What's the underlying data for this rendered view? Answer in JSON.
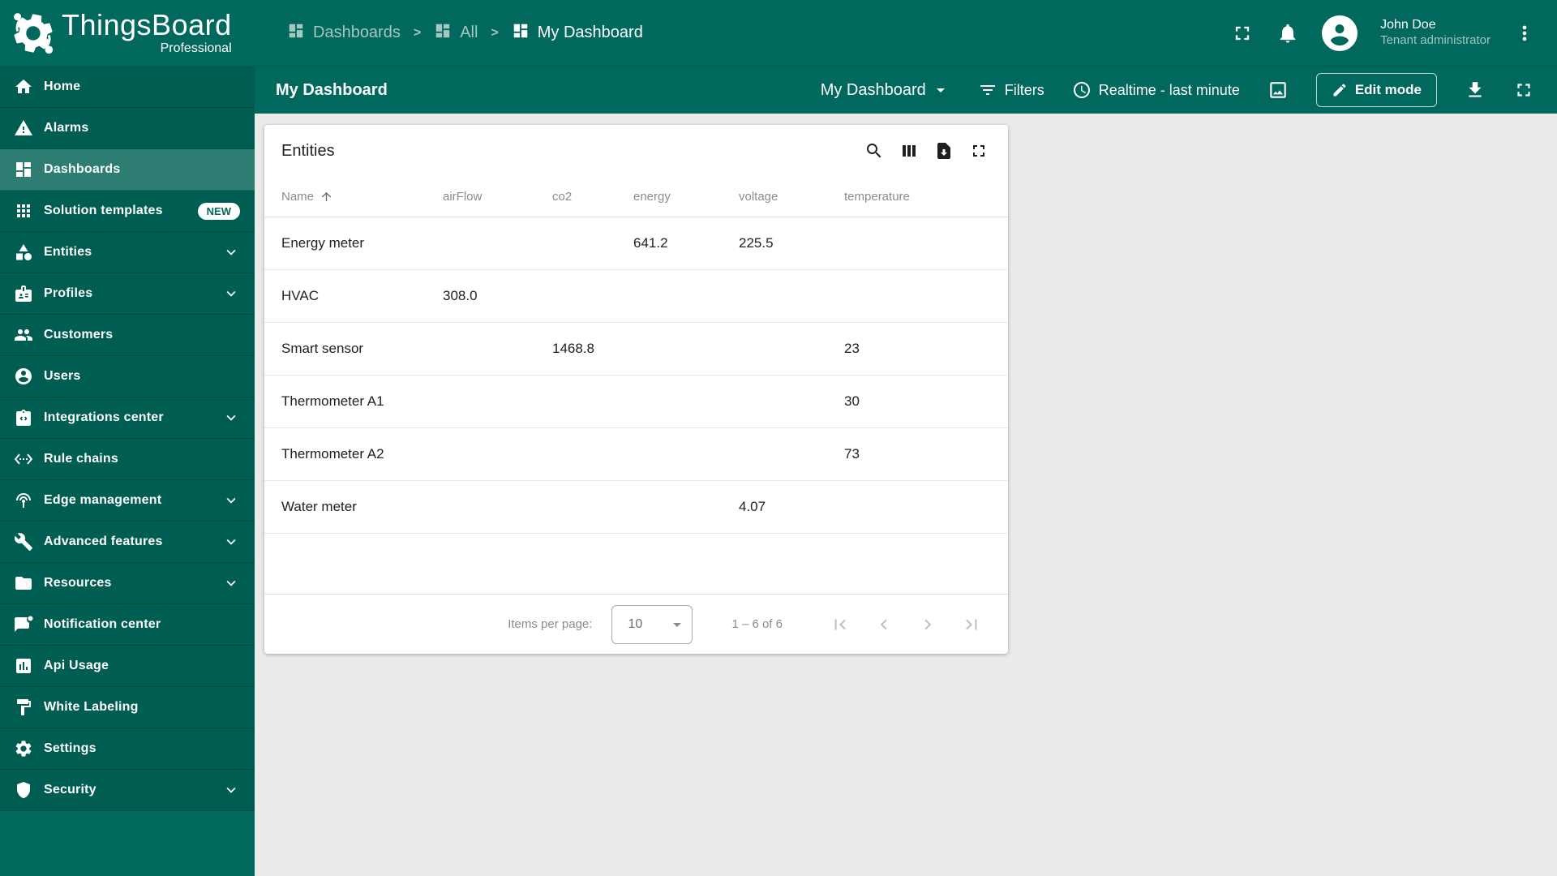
{
  "app": {
    "name": "ThingsBoard",
    "edition": "Professional"
  },
  "header": {
    "separator": ">",
    "breadcrumb": [
      {
        "label": "Dashboards",
        "icon": "dashboard",
        "current": false
      },
      {
        "label": "All",
        "icon": "dashboard",
        "current": false
      },
      {
        "label": "My Dashboard",
        "icon": "dashboard",
        "current": true
      }
    ],
    "user": {
      "name": "John Doe",
      "role": "Tenant administrator"
    }
  },
  "sidebar": {
    "items": [
      {
        "label": "Home",
        "icon": "home"
      },
      {
        "label": "Alarms",
        "icon": "warning"
      },
      {
        "label": "Dashboards",
        "icon": "dashboard",
        "selected": true
      },
      {
        "label": "Solution templates",
        "icon": "apps",
        "badge": "NEW"
      },
      {
        "label": "Entities",
        "icon": "category",
        "expandable": true
      },
      {
        "label": "Profiles",
        "icon": "badge",
        "expandable": true
      },
      {
        "label": "Customers",
        "icon": "people"
      },
      {
        "label": "Users",
        "icon": "person"
      },
      {
        "label": "Integrations center",
        "icon": "integration",
        "expandable": true
      },
      {
        "label": "Rule chains",
        "icon": "rulechain"
      },
      {
        "label": "Edge management",
        "icon": "edge",
        "expandable": true
      },
      {
        "label": "Advanced features",
        "icon": "tools",
        "expandable": true
      },
      {
        "label": "Resources",
        "icon": "folder",
        "expandable": true
      },
      {
        "label": "Notification center",
        "icon": "notification"
      },
      {
        "label": "Api Usage",
        "icon": "chart"
      },
      {
        "label": "White Labeling",
        "icon": "paint"
      },
      {
        "label": "Settings",
        "icon": "gear"
      },
      {
        "label": "Security",
        "icon": "shield",
        "expandable": true
      }
    ]
  },
  "toolbar": {
    "title": "My Dashboard",
    "state_selector": "My Dashboard",
    "filters": "Filters",
    "timewindow": "Realtime - last minute",
    "edit_button": "Edit mode"
  },
  "widget": {
    "title": "Entities",
    "columns": [
      {
        "key": "name",
        "label": "Name",
        "sort": "asc"
      },
      {
        "key": "airFlow",
        "label": "airFlow"
      },
      {
        "key": "co2",
        "label": "co2"
      },
      {
        "key": "energy",
        "label": "energy"
      },
      {
        "key": "voltage",
        "label": "voltage"
      },
      {
        "key": "temperature",
        "label": "temperature"
      }
    ],
    "rows": [
      {
        "name": "Energy meter",
        "airFlow": "",
        "co2": "",
        "energy": "641.2",
        "voltage": "225.5",
        "temperature": ""
      },
      {
        "name": "HVAC",
        "airFlow": "308.0",
        "co2": "",
        "energy": "",
        "voltage": "",
        "temperature": ""
      },
      {
        "name": "Smart sensor",
        "airFlow": "",
        "co2": "1468.8",
        "energy": "",
        "voltage": "",
        "temperature": "23"
      },
      {
        "name": "Thermometer A1",
        "airFlow": "",
        "co2": "",
        "energy": "",
        "voltage": "",
        "temperature": "30"
      },
      {
        "name": "Thermometer A2",
        "airFlow": "",
        "co2": "",
        "energy": "",
        "voltage": "",
        "temperature": "73"
      },
      {
        "name": "Water meter",
        "airFlow": "",
        "co2": "",
        "energy": "",
        "voltage": "4.07",
        "temperature": ""
      }
    ],
    "pagination": {
      "label": "Items per page:",
      "page_size": "10",
      "range": "1 – 6 of 6"
    }
  },
  "colors": {
    "primary": "#00685C",
    "sidebar_item": "#005E53",
    "selected_item": "#2E7D72",
    "canvas": "#EAEAEA",
    "badge_text": "#00685C"
  }
}
